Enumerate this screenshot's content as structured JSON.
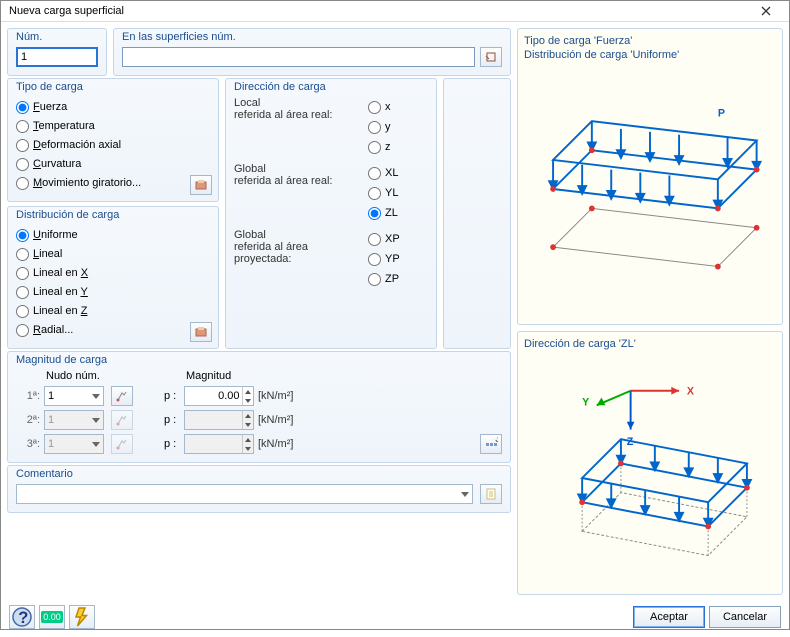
{
  "window": {
    "title": "Nueva carga superficial"
  },
  "numero": {
    "legend": "Núm.",
    "value": "1"
  },
  "superficies": {
    "legend": "En las superficies núm.",
    "value": ""
  },
  "tipoCarga": {
    "legend": "Tipo de carga",
    "options": {
      "fuerza": "Fuerza",
      "temperatura": "Temperatura",
      "deformacion": "Deformación axial",
      "curvatura": "Curvatura",
      "movimiento": "Movimiento giratorio..."
    },
    "selected": "fuerza"
  },
  "distribucion": {
    "legend": "Distribución de carga",
    "options": {
      "uniforme": "Uniforme",
      "lineal": "Lineal",
      "linealx": "Lineal en X",
      "linealy": "Lineal en Y",
      "linealz": "Lineal en Z",
      "radial": "Radial..."
    },
    "selected": "uniforme"
  },
  "direccion": {
    "legend": "Dirección de carga",
    "grupo_local": "Local\nreferida al área real:",
    "grupo_global_real": "Global\nreferida al área real:",
    "grupo_global_proj": "Global\nreferida al área\nproyectada:",
    "opts": {
      "x": "x",
      "y": "y",
      "z": "z",
      "XL": "XL",
      "YL": "YL",
      "ZL": "ZL",
      "XP": "XP",
      "YP": "YP",
      "ZP": "ZP"
    },
    "selected": "ZL"
  },
  "magnitud": {
    "legend": "Magnitud de carga",
    "head_nudo": "Nudo núm.",
    "head_mag": "Magnitud",
    "rows": [
      {
        "label": "1ª:",
        "nudo": "1",
        "p_label": "p :",
        "value": "0.00",
        "unit": "[kN/m²]",
        "enabled": true
      },
      {
        "label": "2ª:",
        "nudo": "1",
        "p_label": "p :",
        "value": "",
        "unit": "[kN/m²]",
        "enabled": false
      },
      {
        "label": "3ª:",
        "nudo": "1",
        "p_label": "p :",
        "value": "",
        "unit": "[kN/m²]",
        "enabled": false
      }
    ]
  },
  "comentario": {
    "legend": "Comentario",
    "value": ""
  },
  "preview1": {
    "line1": "Tipo de carga 'Fuerza'",
    "line2": "Distribución de carga 'Uniforme'",
    "p_label": "P"
  },
  "preview2": {
    "line1": "Dirección de carga 'ZL'",
    "x": "X",
    "y": "Y",
    "z": "Z"
  },
  "footer": {
    "aceptar": "Aceptar",
    "cancelar": "Cancelar"
  }
}
